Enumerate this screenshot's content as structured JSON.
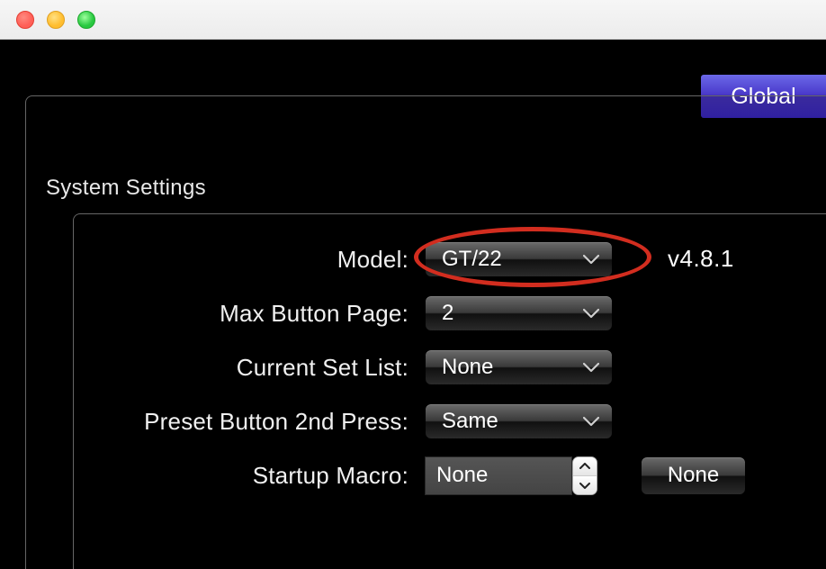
{
  "tabs": {
    "global": "Global"
  },
  "section_title": "System Settings",
  "version": "v4.8.1",
  "fields": {
    "model": {
      "label": "Model:",
      "value": "GT/22"
    },
    "max_button_page": {
      "label": "Max Button Page:",
      "value": "2"
    },
    "current_set_list": {
      "label": "Current Set List:",
      "value": "None"
    },
    "preset_2nd_press": {
      "label": "Preset Button 2nd Press:",
      "value": "Same"
    },
    "startup_macro": {
      "label": "Startup Macro:",
      "value": "None",
      "button": "None"
    }
  }
}
